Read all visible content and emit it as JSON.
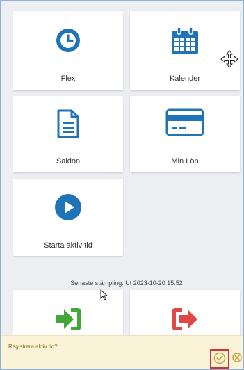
{
  "colors": {
    "primary_blue": "#1f73b7",
    "green": "#43a838",
    "red": "#e04848",
    "banner_bg": "#fbf3d8",
    "highlight_border": "#d23232"
  },
  "tiles": {
    "flex": {
      "label": "Flex",
      "icon": "clock-icon"
    },
    "kalender": {
      "label": "Kalender",
      "icon": "calendar-icon"
    },
    "saldon": {
      "label": "Saldon",
      "icon": "document-icon"
    },
    "min_lon": {
      "label": "Min Lön",
      "icon": "credit-card-icon"
    },
    "starta": {
      "label": "Starta aktiv tid",
      "icon": "play-icon"
    },
    "stampla_in": {
      "icon": "sign-in-icon"
    },
    "stampla_ut": {
      "icon": "sign-out-icon"
    }
  },
  "last_stamp": "Senaste stämpling: Ut 2023-10-20 15:52",
  "banner": {
    "text": "Registrera aktiv tid?",
    "confirm_icon": "check-circle-icon",
    "dismiss_icon": "close-circle-icon"
  }
}
